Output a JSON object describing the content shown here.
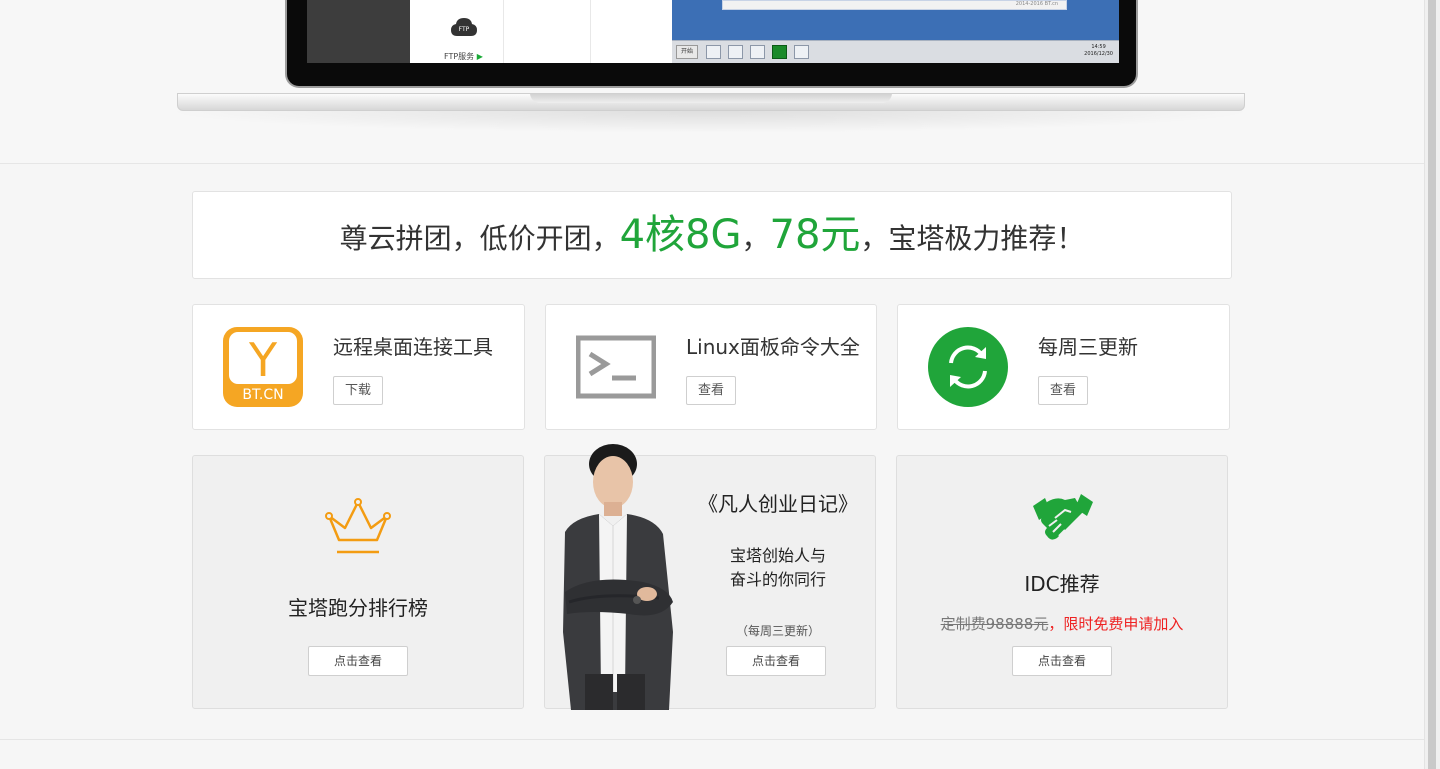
{
  "hero": {
    "ftp_label": "FTP服务",
    "ftp_arrow": "▶",
    "ftp_cloud_text": "FTP",
    "screen_window_text": "2014-2016 BT.cn",
    "taskbar_start": "开始",
    "taskbar_clock_time": "14:59",
    "taskbar_clock_date": "2016/12/30"
  },
  "promo": {
    "part1": "尊云拼团，低价开团，",
    "highlight1": "4核8G",
    "sep": "，",
    "highlight2": "78元",
    "part2": "，宝塔极力推荐！",
    "highlight_color": "#20a53a"
  },
  "tools": [
    {
      "title": "远程桌面连接工具",
      "button": "下载",
      "icon": "bt-remote-desktop-icon",
      "icon_letter": "Y",
      "icon_caption": "BT.CN",
      "icon_color": "#f5a623"
    },
    {
      "title": "Linux面板命令大全",
      "button": "查看",
      "icon": "terminal-icon"
    },
    {
      "title": "每周三更新",
      "button": "查看",
      "icon": "refresh-icon",
      "icon_color": "#20a53a"
    }
  ],
  "features": {
    "ranking": {
      "title": "宝塔跑分排行榜",
      "button": "点击查看",
      "icon": "crown-icon",
      "icon_color": "#f39c12"
    },
    "diary": {
      "title": "《凡人创业日记》",
      "subtitle_line1": "宝塔创始人与",
      "subtitle_line2": "奋斗的你同行",
      "note": "（每周三更新）",
      "button": "点击查看"
    },
    "idc": {
      "title": "IDC推荐",
      "price_strike": "定制费98888元",
      "price_sep": "，",
      "price_offer": "限时免费申请加入",
      "button": "点击查看",
      "icon": "handshake-icon",
      "icon_color": "#20a53a"
    }
  }
}
